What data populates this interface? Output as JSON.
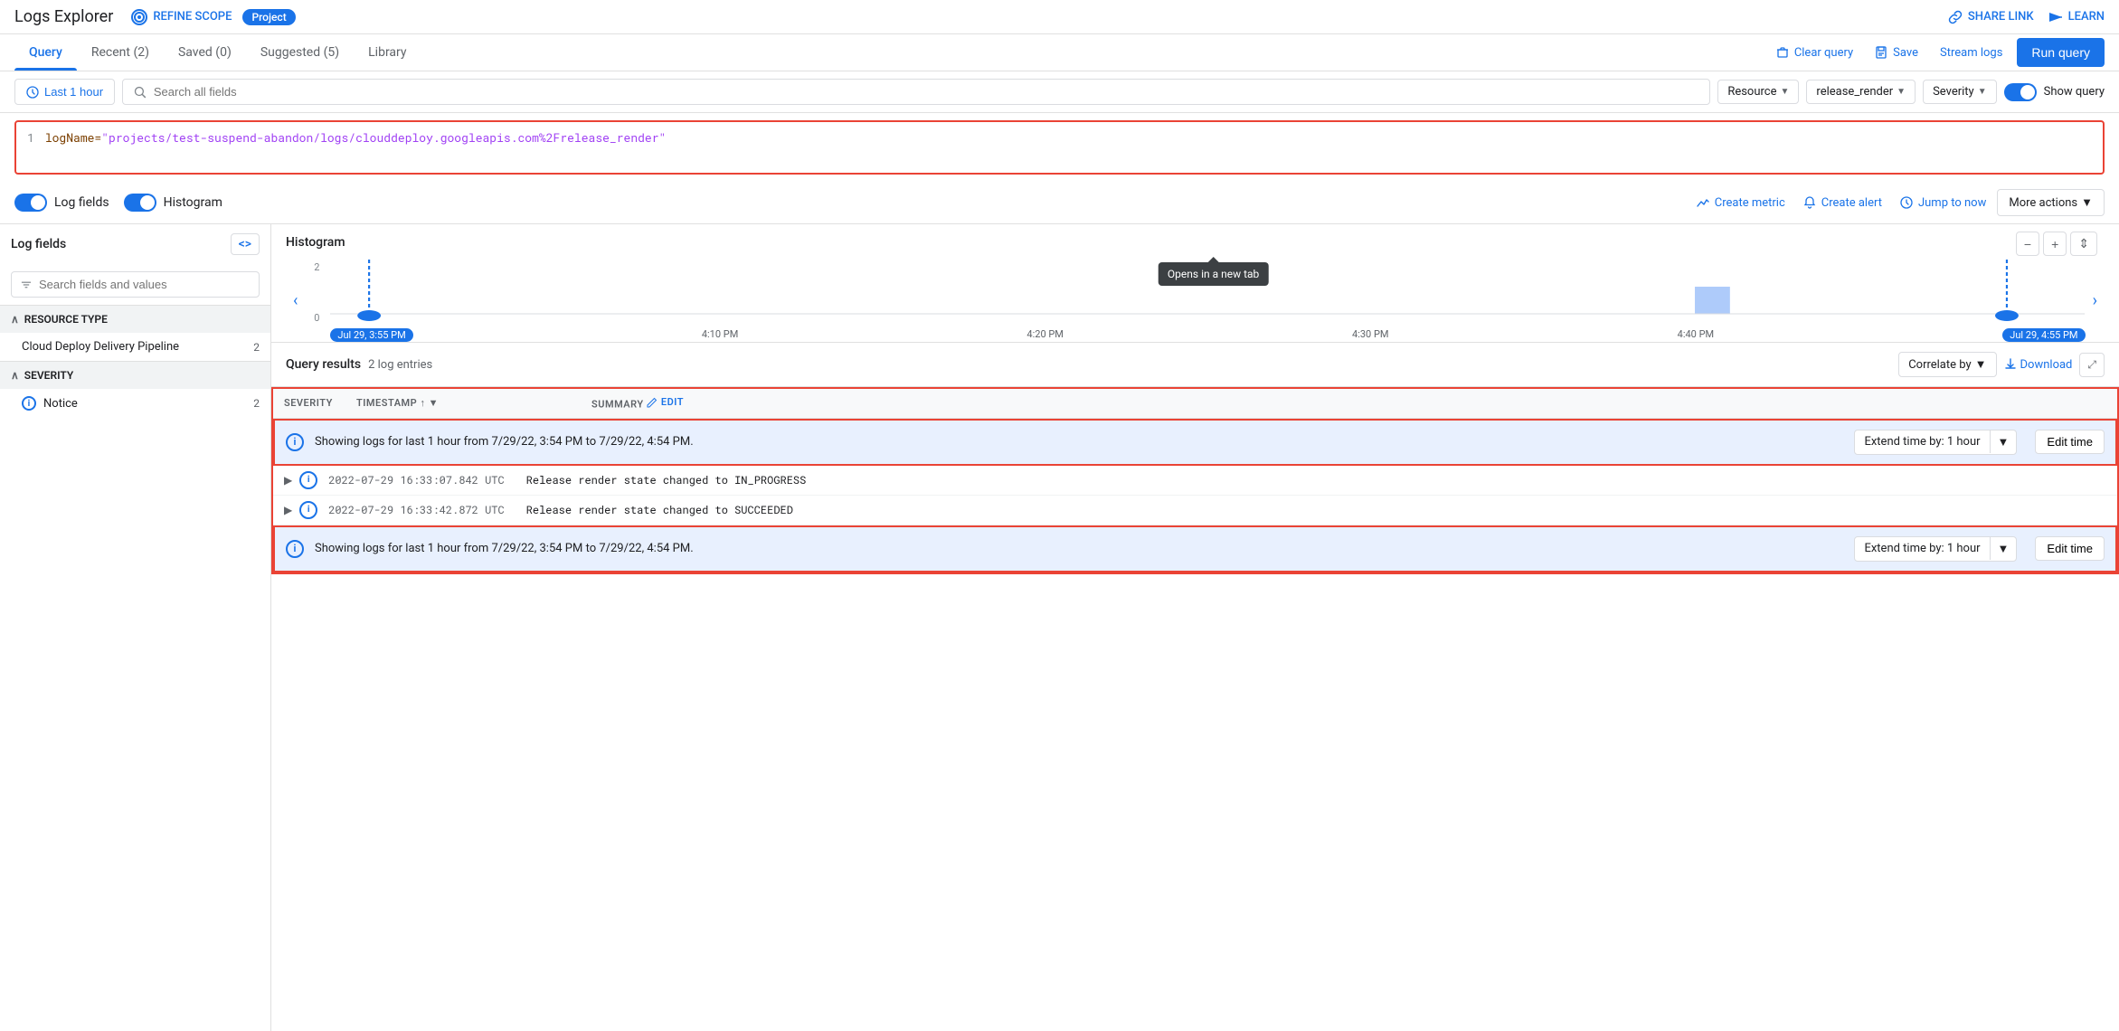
{
  "app": {
    "title": "Logs Explorer",
    "refine_scope": "REFINE SCOPE",
    "project_badge": "Project",
    "share_link": "SHARE LINK",
    "learn": "LEARN"
  },
  "tabs": {
    "items": [
      {
        "label": "Query",
        "active": true
      },
      {
        "label": "Recent (2)",
        "active": false
      },
      {
        "label": "Saved (0)",
        "active": false
      },
      {
        "label": "Suggested (5)",
        "active": false
      },
      {
        "label": "Library",
        "active": false
      }
    ],
    "clear_query": "Clear query",
    "save": "Save",
    "stream_logs": "Stream logs",
    "run_query": "Run query"
  },
  "query_bar": {
    "time_label": "Last 1 hour",
    "search_placeholder": "Search all fields",
    "resource_label": "Resource",
    "filter_label": "release_render",
    "severity_label": "Severity",
    "show_query": "Show query"
  },
  "query_editor": {
    "line_number": "1",
    "query_text": "logName=",
    "query_value": "\"projects/test-suspend-abandon/logs/clouddeploy.googleapis.com%2Frelease_render\""
  },
  "controls": {
    "log_fields_label": "Log fields",
    "histogram_label": "Histogram",
    "create_metric": "Create metric",
    "create_alert": "Create alert",
    "jump_to_now": "Jump to now",
    "more_actions": "More actions"
  },
  "left_panel": {
    "title": "Log fields",
    "search_placeholder": "Search fields and values",
    "sections": [
      {
        "title": "RESOURCE TYPE",
        "items": [
          {
            "name": "Cloud Deploy Delivery Pipeline",
            "count": "2"
          }
        ]
      },
      {
        "title": "SEVERITY",
        "items": [
          {
            "name": "Notice",
            "count": "2",
            "icon": "i"
          }
        ]
      }
    ]
  },
  "histogram": {
    "title": "Histogram",
    "tooltip": "Opens in a new tab",
    "y_labels": [
      "2",
      "0"
    ],
    "time_labels": [
      "Jul 29, 3:55 PM",
      "4:10 PM",
      "4:20 PM",
      "4:30 PM",
      "4:40 PM",
      "Jul 29, 4:55 PM"
    ]
  },
  "results": {
    "title": "Query results",
    "count": "2 log entries",
    "correlate_by": "Correlate by",
    "download": "Download",
    "columns": [
      {
        "label": "SEVERITY"
      },
      {
        "label": "TIMESTAMP",
        "sortable": true
      },
      {
        "label": "SUMMARY",
        "edit": "EDIT"
      }
    ],
    "info_banner": {
      "text": "Showing logs for last 1 hour from 7/29/22, 3:54 PM to 7/29/22, 4:54 PM.",
      "extend_label": "Extend time by: 1 hour",
      "edit_time": "Edit time"
    },
    "log_entries": [
      {
        "severity": "i",
        "timestamp": "2022-07-29 16:33:07.842 UTC",
        "summary": "Release render state changed to IN_PROGRESS"
      },
      {
        "severity": "i",
        "timestamp": "2022-07-29 16:33:42.872 UTC",
        "summary": "Release render state changed to SUCCEEDED"
      }
    ]
  }
}
